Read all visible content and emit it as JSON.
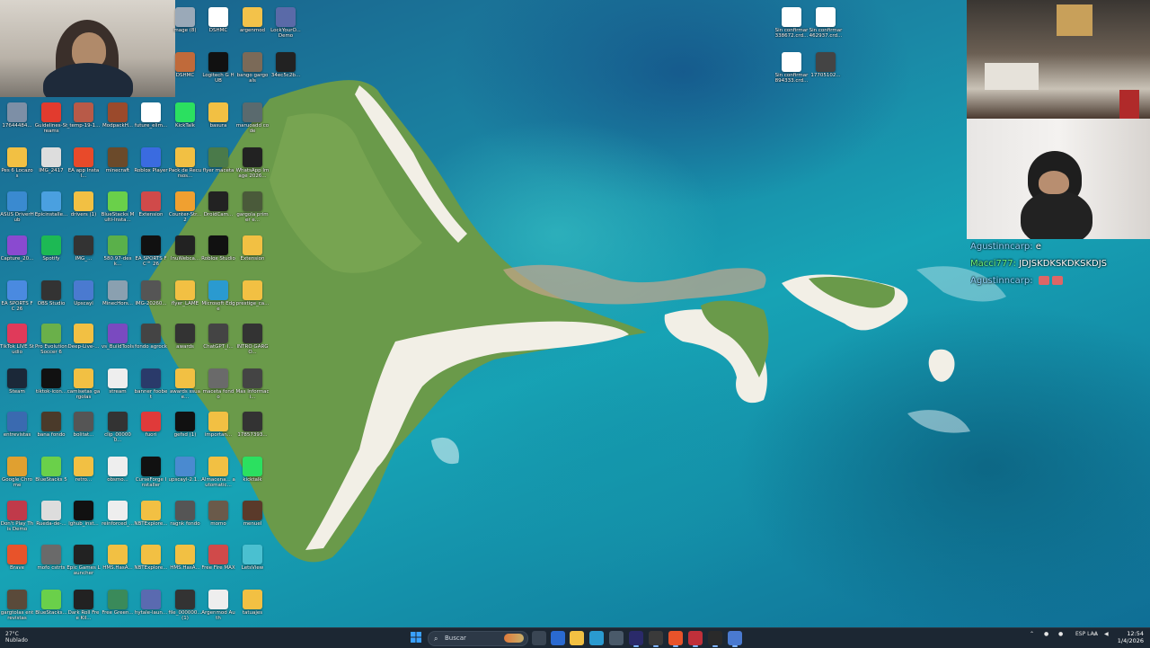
{
  "desktop_icons": [
    {
      "label": "mage (8)",
      "color": "#9aa9b8"
    },
    {
      "label": "DSHMC",
      "color": "#ffffff"
    },
    {
      "label": "argenmod",
      "color": "#f3c24a"
    },
    {
      "label": "LockYourO... Demo",
      "color": "#5a6aa8"
    },
    {
      "label": "DSHMC",
      "color": "#c06a3a"
    },
    {
      "label": "Logitech G HUB",
      "color": "#111111"
    },
    {
      "label": "bango gargoals",
      "color": "#7b6a58"
    },
    {
      "label": "34ec5c2b...",
      "color": "#222222"
    },
    {
      "label": "17644484...",
      "color": "#7d8fa6"
    },
    {
      "label": "Guidelines-Streams",
      "color": "#e23b2e"
    },
    {
      "label": "_temp-19-1...",
      "color": "#b85a48"
    },
    {
      "label": "ModpackH...",
      "color": "#9b4a2c"
    },
    {
      "label": "future_elim...",
      "color": "#ffffff"
    },
    {
      "label": "KickTalk",
      "color": "#2be060"
    },
    {
      "label": "basura",
      "color": "#f2c043"
    },
    {
      "label": "maruoadd code",
      "color": "#5a6a6e"
    },
    {
      "label": "Pes 6 Locazos",
      "color": "#f2c043"
    },
    {
      "label": "IMG_2417",
      "color": "#dddddd"
    },
    {
      "label": "EA app Instal...",
      "color": "#e84a2a"
    },
    {
      "label": "minecraft",
      "color": "#6b4a2a"
    },
    {
      "label": "Roblox Player",
      "color": "#3a6be0"
    },
    {
      "label": "Pack de Recursos...",
      "color": "#f2c043"
    },
    {
      "label": "flyer maceta",
      "color": "#4a7a4a"
    },
    {
      "label": "WhatsApp Image 2026...",
      "color": "#222222"
    },
    {
      "label": "ASUS DriverHub",
      "color": "#3a8ad0"
    },
    {
      "label": "Epicinstalle...",
      "color": "#4aa0e0"
    },
    {
      "label": "drivers (1)",
      "color": "#f2c043"
    },
    {
      "label": "BlueStacks Multi-Insta...",
      "color": "#6ad04a"
    },
    {
      "label": "Extension",
      "color": "#d04a4a"
    },
    {
      "label": "Counter-Str... 2",
      "color": "#f0a030"
    },
    {
      "label": "DroidCam...",
      "color": "#222222"
    },
    {
      "label": "gargola primer e...",
      "color": "#4a5a3a"
    },
    {
      "label": "Capture_20...",
      "color": "#8a4ad0"
    },
    {
      "label": "Spotify",
      "color": "#1db954"
    },
    {
      "label": "IMG_...",
      "color": "#333333"
    },
    {
      "label": "580.97-desk...",
      "color": "#5ab04a"
    },
    {
      "label": "EA SPORTS FC™ 26",
      "color": "#111111"
    },
    {
      "label": "InuWebca...",
      "color": "#222222"
    },
    {
      "label": "Roblox Studio",
      "color": "#111111"
    },
    {
      "label": "Extension",
      "color": "#f2c043"
    },
    {
      "label": "EA SPORTS FC 26",
      "color": "#4a8ae0"
    },
    {
      "label": "OBS Studio",
      "color": "#333333"
    },
    {
      "label": "Upscayl",
      "color": "#4a7ad0"
    },
    {
      "label": "MinecHors...",
      "color": "#8aa0b0"
    },
    {
      "label": "IMG-20260...",
      "color": "#555555"
    },
    {
      "label": "flyer_LAME",
      "color": "#f2c043"
    },
    {
      "label": "Microsoft Edge",
      "color": "#2a9ad0"
    },
    {
      "label": "prestige_ca...",
      "color": "#f2c043"
    },
    {
      "label": "TikTok LIVE Studio",
      "color": "#e03a5a"
    },
    {
      "label": "Pro Evolution Soccer 6",
      "color": "#6ab04a"
    },
    {
      "label": "Deep-Live-...",
      "color": "#f2c043"
    },
    {
      "label": "vs_BuildTools",
      "color": "#7a4ac0"
    },
    {
      "label": "fondo agrock",
      "color": "#444444"
    },
    {
      "label": "awards",
      "color": "#333333"
    },
    {
      "label": "ChatGPT_I...",
      "color": "#444444"
    },
    {
      "label": "INTRO GARGO...",
      "color": "#333333"
    },
    {
      "label": "Steam",
      "color": "#1b2838"
    },
    {
      "label": "tiktok-icon...",
      "color": "#111111"
    },
    {
      "label": "camisetas gargolas",
      "color": "#f2c043"
    },
    {
      "label": "stream",
      "color": "#eeeeee"
    },
    {
      "label": "banner foobet",
      "color": "#2a3a6a"
    },
    {
      "label": "awards ssuae...",
      "color": "#f2c043"
    },
    {
      "label": "maceta fondo",
      "color": "#6a6a6a"
    },
    {
      "label": "Mas Informaci...",
      "color": "#444444"
    },
    {
      "label": "entrevistas",
      "color": "#3a6ab0"
    },
    {
      "label": "bana fondo",
      "color": "#4a3a2a"
    },
    {
      "label": "bolitat...",
      "color": "#555555"
    },
    {
      "label": "clip_000000...",
      "color": "#333333"
    },
    {
      "label": "fuori",
      "color": "#e03a3a"
    },
    {
      "label": "gefsd (1)",
      "color": "#111111"
    },
    {
      "label": "importan...",
      "color": "#f2c043"
    },
    {
      "label": "17857393...",
      "color": "#333333"
    },
    {
      "label": "Google Chrome",
      "color": "#e0a030"
    },
    {
      "label": "BlueStacks 5",
      "color": "#6ad04a"
    },
    {
      "label": "retro...",
      "color": "#f2c043"
    },
    {
      "label": "obsmo...",
      "color": "#eeeeee"
    },
    {
      "label": "CurseForge Installer",
      "color": "#111111"
    },
    {
      "label": "upscayl-2.1...",
      "color": "#4a8ad0"
    },
    {
      "label": "Almacena... automatic...",
      "color": "#f2c043"
    },
    {
      "label": "kicktalk",
      "color": "#2be060"
    },
    {
      "label": "Don't Play This Demo",
      "color": "#c03a4a"
    },
    {
      "label": "Rueda-de-...",
      "color": "#dddddd"
    },
    {
      "label": "lghub_inst...",
      "color": "#111111"
    },
    {
      "label": "reinforced_...",
      "color": "#eeeeee"
    },
    {
      "label": "NBTExplore...",
      "color": "#f2c043"
    },
    {
      "label": "ragnk fondo",
      "color": "#555555"
    },
    {
      "label": "momo",
      "color": "#6a5a4a"
    },
    {
      "label": "menuel",
      "color": "#5a3a2a"
    },
    {
      "label": "Brave",
      "color": "#e8532a"
    },
    {
      "label": "mofo cstrts",
      "color": "#6a6a6a"
    },
    {
      "label": "Epic Games Launcher",
      "color": "#222222"
    },
    {
      "label": "HMS.HasA...",
      "color": "#f2c043"
    },
    {
      "label": "NBTExplore...",
      "color": "#f2c043"
    },
    {
      "label": "HMS.HasA...",
      "color": "#f2c043"
    },
    {
      "label": "Free Fire MAX",
      "color": "#d04a4a"
    },
    {
      "label": "LetsView",
      "color": "#4ac0d0"
    },
    {
      "label": "gargtolas entrevistas",
      "color": "#5a4a3a"
    },
    {
      "label": "BlueStacks...",
      "color": "#6ad04a"
    },
    {
      "label": "Dark Roll Free Kil...",
      "color": "#222222"
    },
    {
      "label": "Free Green...",
      "color": "#3a8a5a"
    },
    {
      "label": "hytale-laun...",
      "color": "#5a6ab0"
    },
    {
      "label": "file_000000... (1)",
      "color": "#333333"
    },
    {
      "label": "Argenmod Auth",
      "color": "#eeeeee"
    },
    {
      "label": "tatuajes",
      "color": "#f2c043"
    },
    {
      "label": "Sin confirmar 338672.crd...",
      "color": "#ffffff"
    },
    {
      "label": "Sin confirmar 462937.crd...",
      "color": "#ffffff"
    },
    {
      "label": "Sin confirmar 894333.crd...",
      "color": "#ffffff"
    },
    {
      "label": "17705102...",
      "color": "#444444"
    }
  ],
  "chat": [
    {
      "user": "Agustinncarp:",
      "message": "e"
    },
    {
      "user": "Macci777:",
      "message": "JDJSKDKSKDKSKDJS"
    },
    {
      "user": "Agustinncarp:",
      "message": ""
    }
  ],
  "taskbar": {
    "weather_temp": "27°C",
    "weather_desc": "Nublado",
    "search_placeholder": "Buscar",
    "tray_lang": "ESP LAA",
    "time": "12:54",
    "date": "1/4/2026"
  }
}
